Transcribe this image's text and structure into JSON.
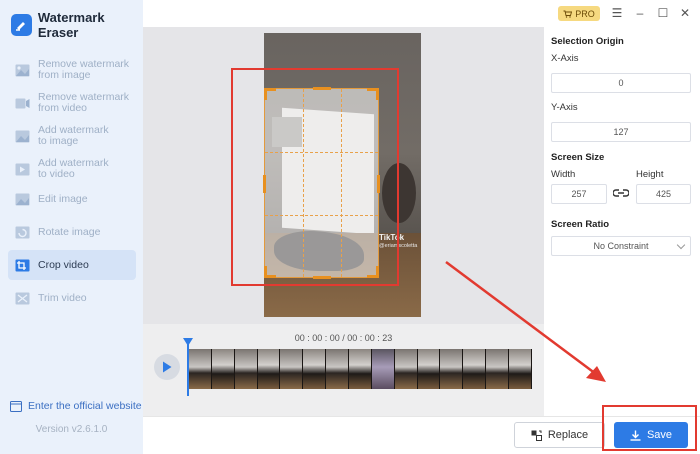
{
  "app": {
    "title": "Watermark Eraser",
    "version": "Version v2.6.1.0",
    "website_link": "Enter the official website"
  },
  "sidebar": {
    "items": [
      {
        "label_line1": "Remove watermark",
        "label_line2": "from image",
        "icon": "image-eraser-icon",
        "active": false
      },
      {
        "label_line1": "Remove watermark",
        "label_line2": "from video",
        "icon": "video-eraser-icon",
        "active": false
      },
      {
        "label_line1": "Add watermark",
        "label_line2": "to image",
        "icon": "image-add-icon",
        "active": false
      },
      {
        "label_line1": "Add watermark",
        "label_line2": "to video",
        "icon": "video-add-icon",
        "active": false
      },
      {
        "label_line1": "Edit image",
        "label_line2": "",
        "icon": "edit-image-icon",
        "active": false
      },
      {
        "label_line1": "Rotate image",
        "label_line2": "",
        "icon": "rotate-icon",
        "active": false
      },
      {
        "label_line1": "Crop video",
        "label_line2": "",
        "icon": "crop-icon",
        "active": true
      },
      {
        "label_line1": "Trim video",
        "label_line2": "",
        "icon": "trim-icon",
        "active": false
      }
    ]
  },
  "titlebar": {
    "pro_label": "PRO"
  },
  "video": {
    "watermark_brand": "TikTok",
    "watermark_user": "@eriamscoletta"
  },
  "timeline": {
    "timecode": "00 : 00 : 00 / 00 : 00 : 23"
  },
  "panel": {
    "selection_origin_label": "Selection Origin",
    "x_axis_label": "X-Axis",
    "x_axis_value": "0",
    "y_axis_label": "Y-Axis",
    "y_axis_value": "127",
    "screen_size_label": "Screen Size",
    "width_label": "Width",
    "width_value": "257",
    "height_label": "Height",
    "height_value": "425",
    "screen_ratio_label": "Screen Ratio",
    "screen_ratio_value": "No Constraint"
  },
  "actions": {
    "replace_label": "Replace",
    "save_label": "Save"
  },
  "colors": {
    "accent": "#2d7be5",
    "highlight_red": "#e23a30",
    "crop_orange": "#e8901f",
    "pro_gold": "#f6d980"
  }
}
